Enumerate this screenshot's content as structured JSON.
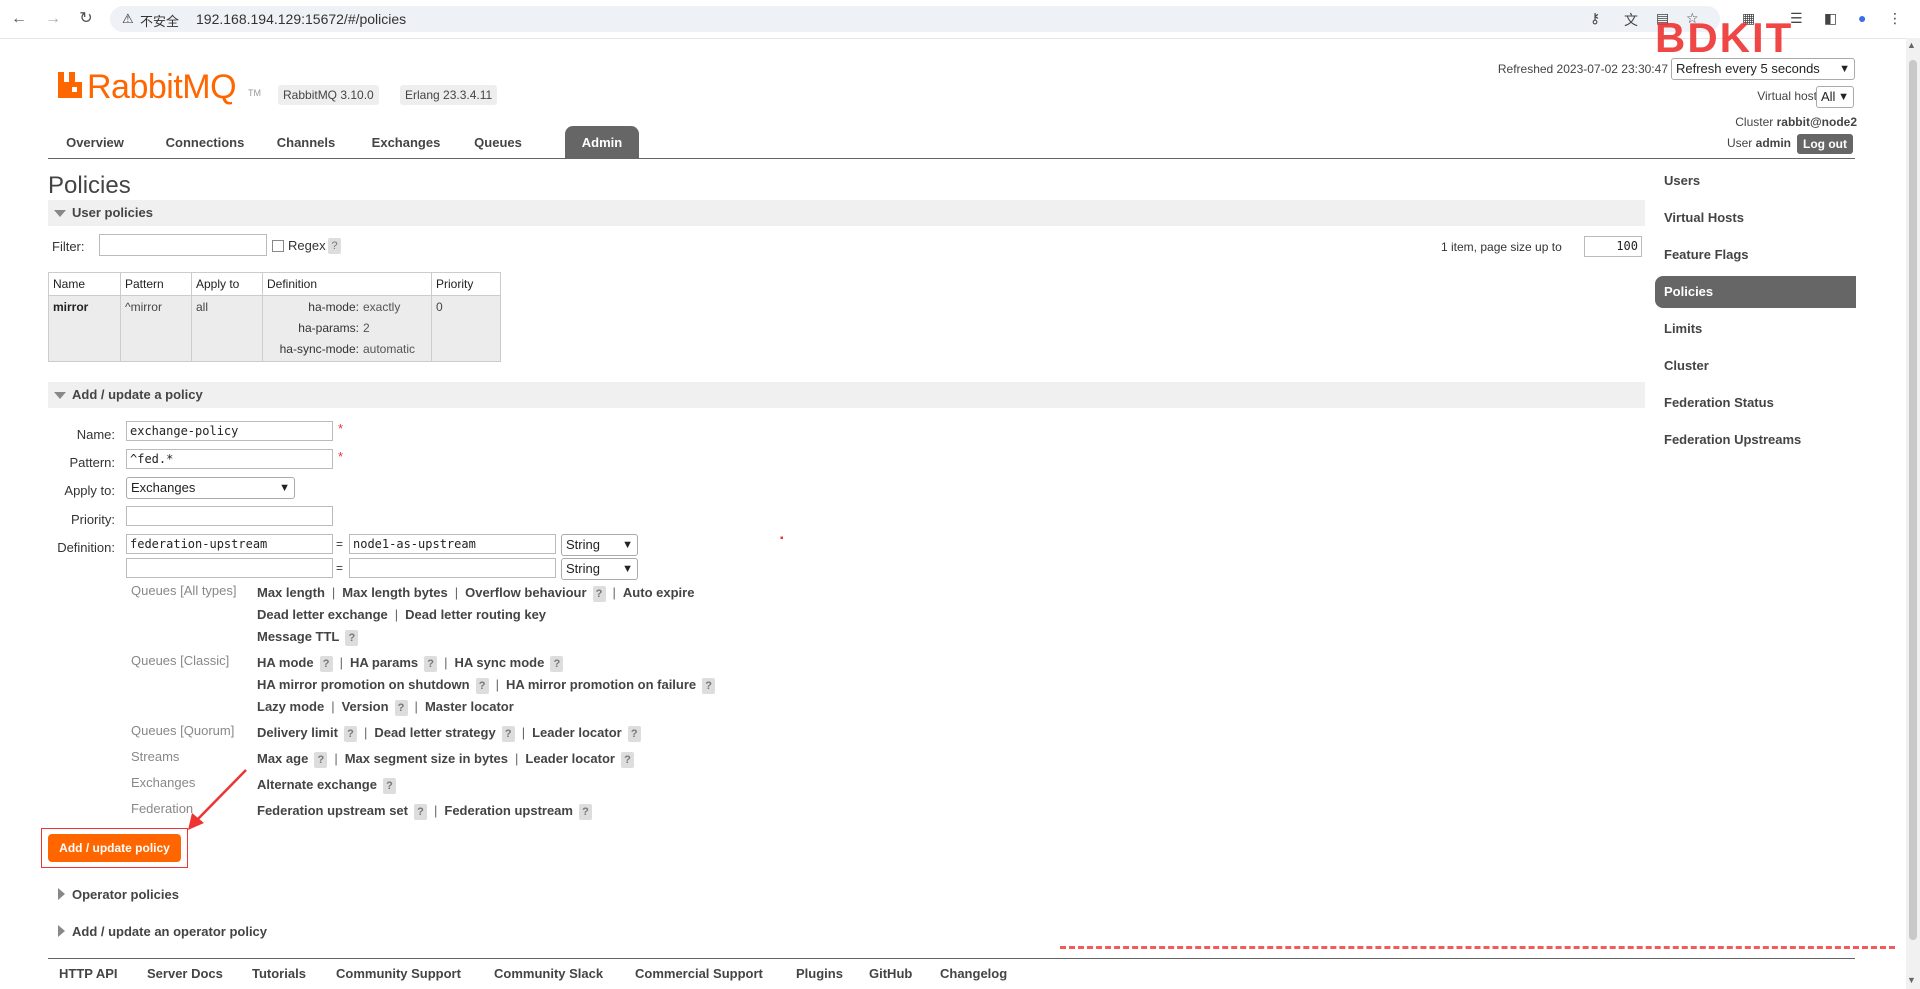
{
  "browser": {
    "insecure_label": "不安全",
    "url": "192.168.194.129:15672/#/policies"
  },
  "header": {
    "logo_text": "RabbitMQ",
    "logo_tm": "TM",
    "version": "RabbitMQ 3.10.0",
    "erlang": "Erlang 23.3.4.11",
    "refreshed_label": "Refreshed 2023-07-02 23:30:47",
    "refresh_select": "Refresh every 5 seconds",
    "vhost_label": "Virtual host",
    "vhost_select": "All",
    "cluster_label": "Cluster",
    "cluster_name": "rabbit@node2",
    "user_label": "User",
    "user_name": "admin",
    "logout": "Log out"
  },
  "tabs": [
    "Overview",
    "Connections",
    "Channels",
    "Exchanges",
    "Queues",
    "Admin"
  ],
  "right_nav": [
    "Users",
    "Virtual Hosts",
    "Feature Flags",
    "Policies",
    "Limits",
    "Cluster",
    "Federation Status",
    "Federation Upstreams"
  ],
  "page_title": "Policies",
  "user_policies": {
    "title": "User policies",
    "filter_label": "Filter:",
    "regex_label": "Regex",
    "q": "?",
    "paging_label": "1 item, page size up to",
    "page_size": "100",
    "columns": [
      "Name",
      "Pattern",
      "Apply to",
      "Definition",
      "Priority"
    ],
    "rows": [
      {
        "name": "mirror",
        "pattern": "^mirror",
        "apply_to": "all",
        "definition": [
          {
            "key": "ha-mode:",
            "value": "exactly"
          },
          {
            "key": "ha-params:",
            "value": "2"
          },
          {
            "key": "ha-sync-mode:",
            "value": "automatic"
          }
        ],
        "priority": "0"
      }
    ]
  },
  "add_policy": {
    "title": "Add / update a policy",
    "name_label": "Name:",
    "name_value": "exchange-policy",
    "pattern_label": "Pattern:",
    "pattern_value": "^fed.*",
    "apply_label": "Apply to:",
    "apply_value": "Exchanges",
    "priority_label": "Priority:",
    "priority_value": "",
    "definition_label": "Definition:",
    "def_key_1": "federation-upstream",
    "def_val_1": "node1-as-upstream",
    "def_type_1": "String",
    "def_key_2": "",
    "def_val_2": "",
    "def_type_2": "String",
    "eq": "=",
    "required": "*",
    "button": "Add / update policy"
  },
  "helpers": {
    "cat_all": "Queues [All types]",
    "cat_classic": "Queues [Classic]",
    "cat_quorum": "Queues [Quorum]",
    "cat_streams": "Streams",
    "cat_exchanges": "Exchanges",
    "cat_federation": "Federation",
    "max_length": "Max length",
    "max_length_bytes": "Max length bytes",
    "overflow": "Overflow behaviour",
    "auto_expire": "Auto expire",
    "dlx": "Dead letter exchange",
    "dlrk": "Dead letter routing key",
    "msg_ttl": "Message TTL",
    "ha_mode": "HA mode",
    "ha_params": "HA params",
    "ha_sync": "HA sync mode",
    "ha_promo_shutdown": "HA mirror promotion on shutdown",
    "ha_promo_failure": "HA mirror promotion on failure",
    "lazy": "Lazy mode",
    "version": "Version",
    "master_locator": "Master locator",
    "delivery_limit": "Delivery limit",
    "dl_strategy": "Dead letter strategy",
    "leader_locator": "Leader locator",
    "max_age": "Max age",
    "max_seg": "Max segment size in bytes",
    "alt_exchange": "Alternate exchange",
    "fed_upstream_set": "Federation upstream set",
    "fed_upstream": "Federation upstream",
    "sep": "|"
  },
  "operator_policies": "Operator policies",
  "add_operator_policy": "Add / update an operator policy",
  "footer": [
    "HTTP API",
    "Server Docs",
    "Tutorials",
    "Community Support",
    "Community Slack",
    "Commercial Support",
    "Plugins",
    "GitHub",
    "Changelog"
  ],
  "colors": {
    "accent": "#ff6600",
    "tab_active": "#666666",
    "annotation": "#ee3333"
  }
}
